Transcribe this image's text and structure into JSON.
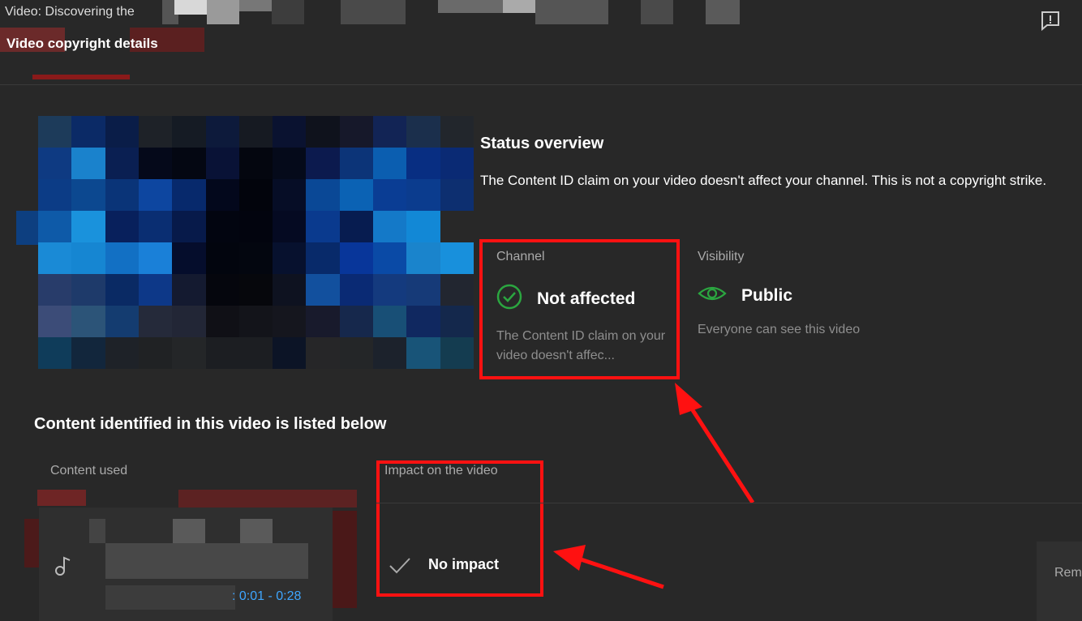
{
  "header": {
    "video_title": "Video: Discovering the",
    "dialog_title": "Video copyright details",
    "feedback_icon": "feedback-icon"
  },
  "status": {
    "title": "Status overview",
    "description": "The Content ID claim on your video doesn't affect your channel. This is not a copyright strike."
  },
  "channel_card": {
    "label": "Channel",
    "value": "Not affected",
    "sub": "The Content ID claim on your video doesn't affec...",
    "icon": "check-circle-icon",
    "icon_color": "#2ba640"
  },
  "visibility_card": {
    "label": "Visibility",
    "value": "Public",
    "sub": "Everyone can see this video",
    "icon": "eye-icon",
    "icon_color": "#2ba640"
  },
  "content": {
    "title": "Content identified in this video is listed below",
    "col_content": "Content used",
    "col_impact": "Impact on the video",
    "rows": [
      {
        "time_range": ": 0:01 - 0:28",
        "impact": "No impact",
        "icon": "music-note-icon"
      }
    ],
    "action_partial": "Rem"
  },
  "colors": {
    "background": "#282828",
    "annotation_red": "#ff1111",
    "link_blue": "#3ea6ff"
  }
}
